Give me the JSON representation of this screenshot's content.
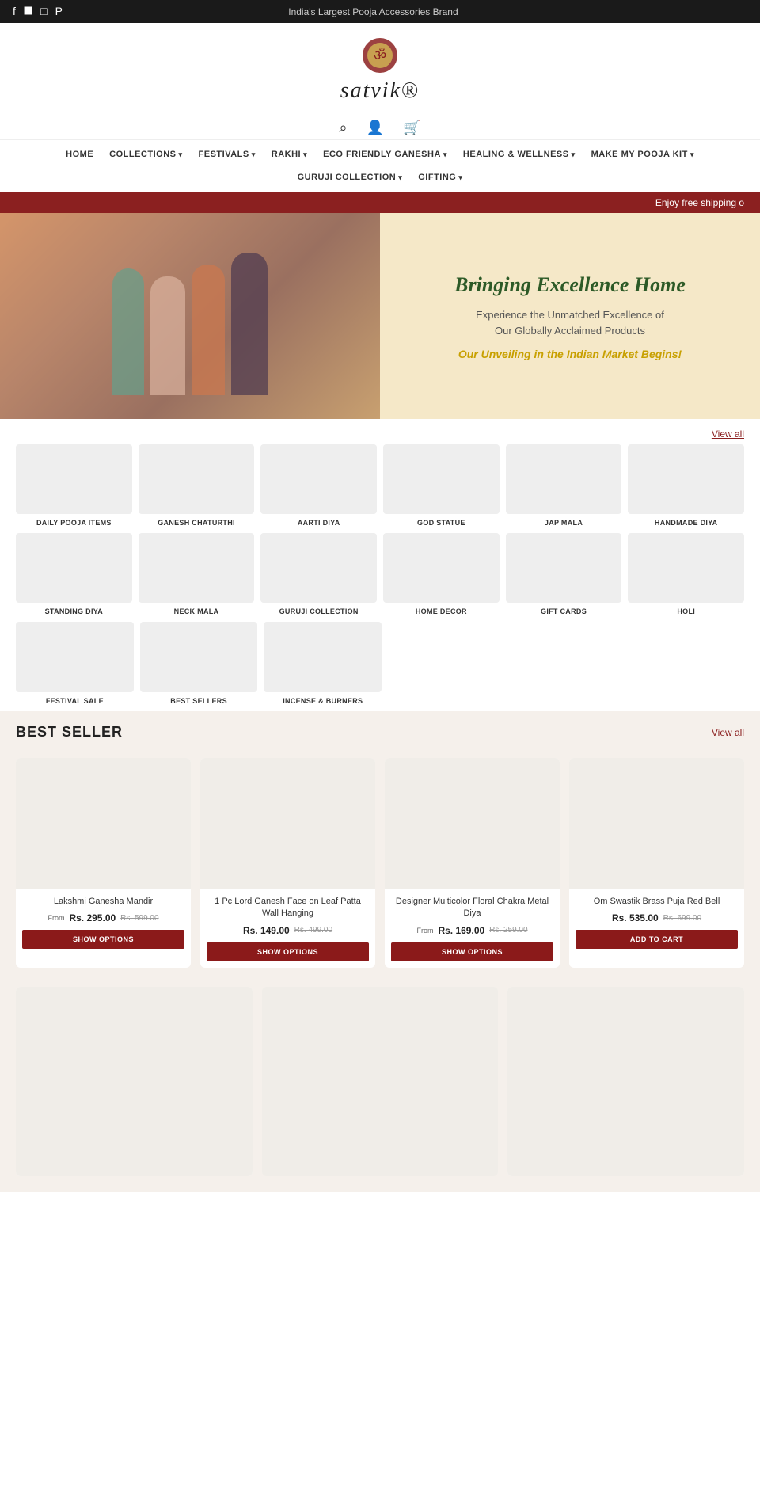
{
  "topbar": {
    "announcement": "India's Largest Pooja Accessories Brand",
    "icons": [
      "fb",
      "yt",
      "ig",
      "pin"
    ]
  },
  "logo": {
    "text": "satvik",
    "tagline": "®"
  },
  "nav": {
    "row1": [
      {
        "label": "HOME",
        "hasDropdown": false
      },
      {
        "label": "COLLECTIONS",
        "hasDropdown": true
      },
      {
        "label": "FESTIVALS",
        "hasDropdown": true
      },
      {
        "label": "RAKHI",
        "hasDropdown": true
      },
      {
        "label": "ECO FRIENDLY GANESHA",
        "hasDropdown": true
      },
      {
        "label": "HEALING & WELLNESS",
        "hasDropdown": true
      },
      {
        "label": "MAKE MY POOJA KIT",
        "hasDropdown": true
      }
    ],
    "row2": [
      {
        "label": "GURUJI COLLECTION",
        "hasDropdown": true
      },
      {
        "label": "GIFTING",
        "hasDropdown": true
      }
    ]
  },
  "shipping": {
    "text": "Enjoy free shipping o"
  },
  "hero": {
    "title": "Bringing Excellence Home",
    "subtitle": "Experience the Unmatched Excellence of\nOur Globally Acclaimed Products",
    "cta": "Our Unveiling in the Indian Market Begins!"
  },
  "collections": {
    "view_all": "View all",
    "row1": [
      {
        "label": "DAILY POOJA ITEMS"
      },
      {
        "label": "Ganesh Chaturthi"
      },
      {
        "label": "AARTI DIYA"
      },
      {
        "label": "GOD STATUE"
      },
      {
        "label": "JAP MALA"
      },
      {
        "label": "HANDMADE DIYA"
      }
    ],
    "row2": [
      {
        "label": "STANDING DIYA"
      },
      {
        "label": "Neck Mala"
      },
      {
        "label": "GURUJI COLLECTION"
      },
      {
        "label": "HOME DECOR"
      },
      {
        "label": "GIFT CARDS"
      },
      {
        "label": "HOLI"
      }
    ],
    "row3": [
      {
        "label": "FESTIVAL SALE"
      },
      {
        "label": "BEST SELLERS"
      },
      {
        "label": "INCENSE & BURNERS"
      }
    ]
  },
  "bestseller": {
    "title": "BEST SELLER",
    "view_all": "View all",
    "products": [
      {
        "name": "Lakshmi Ganesha Mandir",
        "price_from": "From",
        "price_current": "Rs. 295.00",
        "price_original": "Rs. 599.00",
        "btn_label": "SHOW OPTIONS"
      },
      {
        "name": "1 Pc Lord Ganesh Face on Leaf Patta Wall Hanging",
        "price_from": "",
        "price_current": "Rs. 149.00",
        "price_original": "Rs. 499.00",
        "btn_label": "SHOW OPTIONS"
      },
      {
        "name": "Designer Multicolor Floral Chakra Metal Diya",
        "price_from": "From",
        "price_current": "Rs. 169.00",
        "price_original": "Rs. 259.00",
        "btn_label": "SHOW OPTIONS"
      },
      {
        "name": "Om Swastik Brass Puja Red Bell",
        "price_from": "",
        "price_current": "Rs. 535.00",
        "price_original": "Rs. 699.00",
        "btn_label": "ADD TO CART"
      }
    ]
  }
}
